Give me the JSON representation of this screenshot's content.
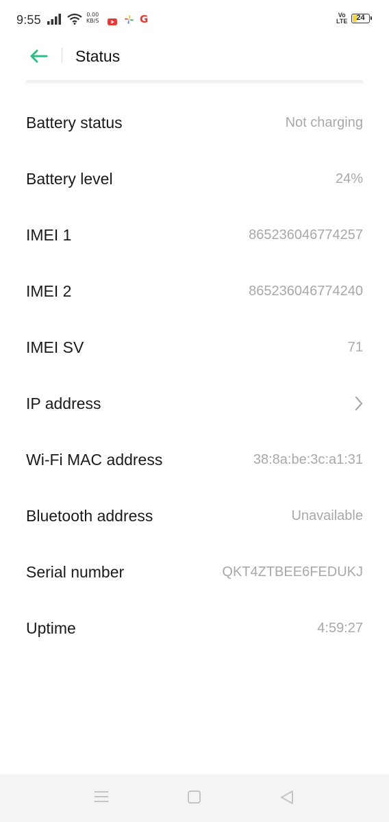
{
  "status_bar": {
    "time": "9:55",
    "net_speed_value": "0.00",
    "net_speed_unit": "KB/S",
    "volte_line1": "Vo",
    "volte_line2": "LTE",
    "battery_percent_text": "24",
    "battery_level": 0.24,
    "icons": [
      "signal-icon",
      "wifi-icon",
      "youtube-icon",
      "pinwheel-icon",
      "google-icon",
      "battery-icon"
    ]
  },
  "header": {
    "title": "Status",
    "accent_color": "#2ebd85"
  },
  "rows": [
    {
      "label": "Battery status",
      "value": "Not charging"
    },
    {
      "label": "Battery level",
      "value": "24%"
    },
    {
      "label": "IMEI 1",
      "value": "865236046774257"
    },
    {
      "label": "IMEI 2",
      "value": "865236046774240"
    },
    {
      "label": "IMEI SV",
      "value": "71"
    },
    {
      "label": "IP address",
      "value": "",
      "chevron": true
    },
    {
      "label": "Wi-Fi MAC address",
      "value": "38:8a:be:3c:a1:31"
    },
    {
      "label": "Bluetooth address",
      "value": "Unavailable"
    },
    {
      "label": "Serial number",
      "value": "QKT4ZTBEE6FEDUKJ"
    },
    {
      "label": "Uptime",
      "value": "4:59:27"
    }
  ],
  "navbar": {
    "icons": [
      "menu-icon",
      "home-icon",
      "back-icon"
    ]
  }
}
